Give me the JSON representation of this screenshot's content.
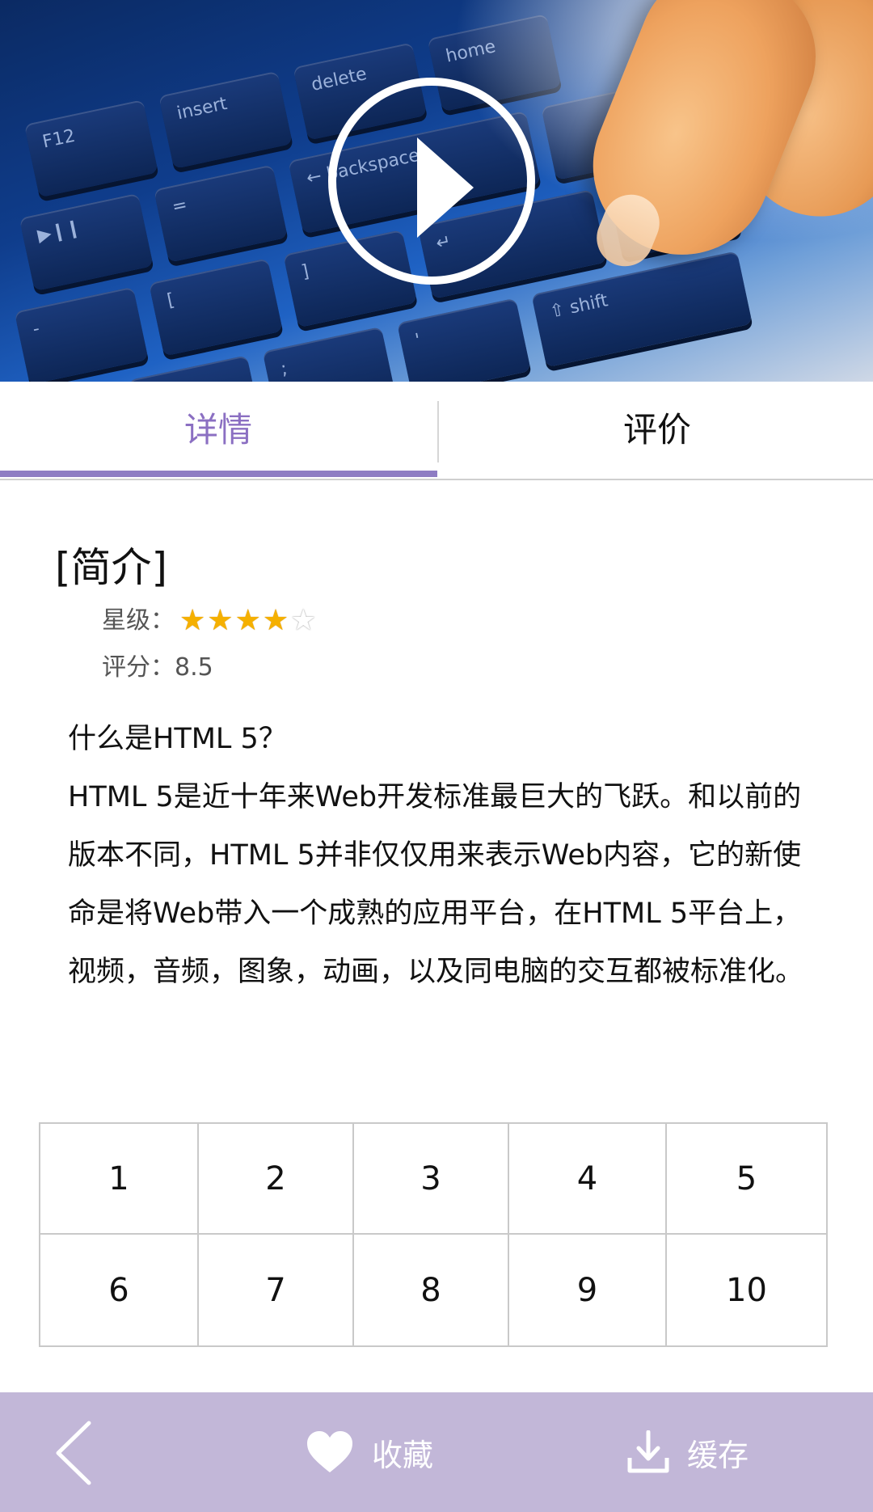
{
  "tabs": {
    "detail": "详情",
    "review": "评价"
  },
  "intro": {
    "title": "[简介]",
    "stars_label": "星级：",
    "stars_rating": 4,
    "stars_max": 5,
    "score_label": "评分：",
    "score_value": "8.5"
  },
  "description": {
    "question": "什么是HTML 5？",
    "body": "HTML 5是近十年来Web开发标准最巨大的飞跃。和以前的版本不同，HTML 5并非仅仅用来表示Web内容，它的新使命是将Web带入一个成熟的应用平台，在HTML 5平台上，视频，音频，图象，动画，以及同电脑的交互都被标准化。"
  },
  "episodes": [
    "1",
    "2",
    "3",
    "4",
    "5",
    "6",
    "7",
    "8",
    "9",
    "10"
  ],
  "bottom_bar": {
    "favorite_label": "收藏",
    "cache_label": "缓存"
  },
  "colors": {
    "accent": "#8e7cc3",
    "bottom_bar": "#c2b7d8",
    "star": "#f5b000"
  },
  "icons": {
    "play": "play-icon",
    "back": "chevron-left-icon",
    "favorite": "heart-icon",
    "cache": "download-icon",
    "star_full": "star-filled-icon",
    "star_empty": "star-outline-icon"
  }
}
